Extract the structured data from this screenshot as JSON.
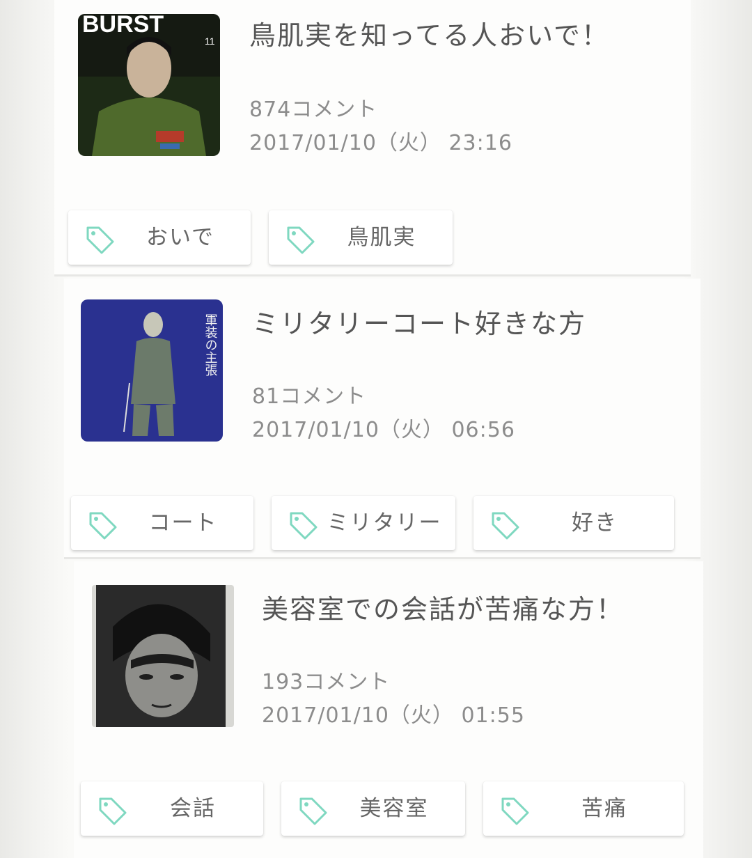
{
  "accent_color": "#7fd8c0",
  "tag_icon_name": "tag-icon",
  "topics": [
    {
      "title": "鳥肌実を知ってる人おいで！",
      "comments": "874コメント",
      "date": "2017/01/10（火） 23:16",
      "thumbnail": {
        "masthead": "BURST",
        "issue": "11"
      },
      "tags": [
        "おいで",
        "鳥肌実"
      ]
    },
    {
      "title": "ミリタリーコート好きな方",
      "comments": "81コメント",
      "date": "2017/01/10（火） 06:56",
      "thumbnail": {
        "caption": "軍装の主張"
      },
      "tags": [
        "コート",
        "ミリタリー",
        "好き"
      ]
    },
    {
      "title": "美容室での会話が苦痛な方！",
      "comments": "193コメント",
      "date": "2017/01/10（火） 01:55",
      "thumbnail": {},
      "tags": [
        "会話",
        "美容室",
        "苦痛"
      ]
    }
  ]
}
